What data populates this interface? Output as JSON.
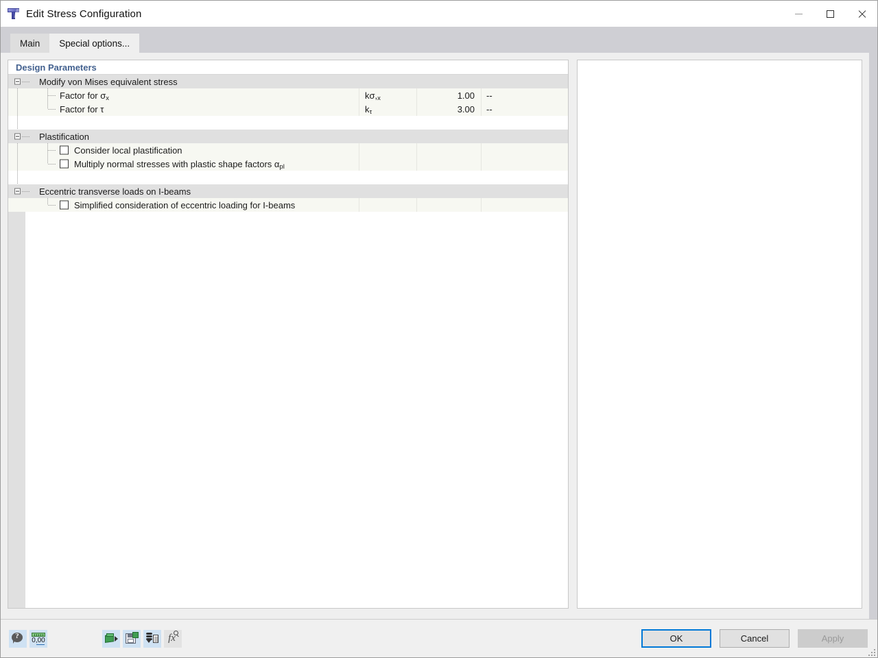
{
  "window": {
    "title": "Edit Stress Configuration",
    "icon": "rfem-section-icon",
    "controls": {
      "minimize": "minimize-icon",
      "maximize": "maximize-icon",
      "close": "close-icon"
    }
  },
  "tabs": [
    {
      "label": "Main",
      "active": false
    },
    {
      "label": "Special options...",
      "active": true
    }
  ],
  "panel": {
    "header": "Design Parameters",
    "groups": [
      {
        "title": "Modify von Mises equivalent stress",
        "rows": [
          {
            "label": "Factor for σx",
            "label_base": "Factor for σ",
            "label_sub": "x",
            "symbol_base": "kσ,",
            "symbol_sub": "x",
            "symbol_full": "kσ,x",
            "value": "1.00",
            "unit": "--"
          },
          {
            "label": "Factor for τ",
            "label_base": "Factor for τ",
            "label_sub": "",
            "symbol_base": "k",
            "symbol_sub": "τ",
            "symbol_full": "kτ",
            "value": "3.00",
            "unit": "--"
          }
        ]
      },
      {
        "title": "Plastification",
        "checkrows": [
          {
            "label": "Consider local plastification",
            "checked": false
          },
          {
            "label": "Multiply normal stresses with plastic shape factors αpl",
            "label_base": "Multiply normal stresses with plastic shape factors α",
            "label_sub": "pl",
            "checked": false
          }
        ]
      },
      {
        "title": "Eccentric transverse loads on I-beams",
        "checkrows": [
          {
            "label": "Simplified consideration of eccentric loading for I-beams",
            "checked": false
          }
        ]
      }
    ]
  },
  "toolbar": [
    {
      "name": "help-icon",
      "style": "blue"
    },
    {
      "name": "units-decimals-icon",
      "style": "blue",
      "text": "0,00"
    },
    {
      "name": "import-green-icon",
      "style": "blue"
    },
    {
      "name": "save-green-icon",
      "style": "blue"
    },
    {
      "name": "database-export-icon",
      "style": "blue"
    },
    {
      "name": "formula-fx-icon",
      "style": "plain",
      "text": "fx"
    }
  ],
  "buttons": {
    "ok": "OK",
    "cancel": "Cancel",
    "apply": "Apply"
  }
}
